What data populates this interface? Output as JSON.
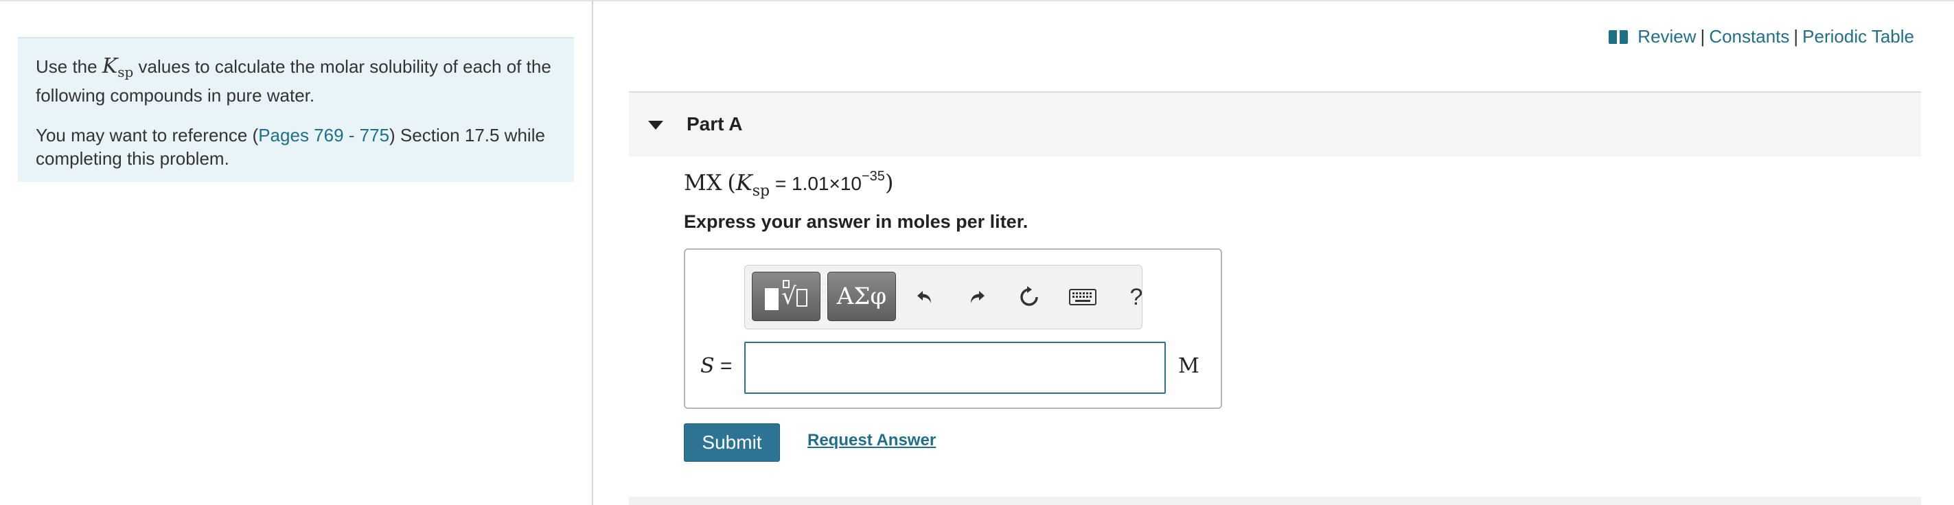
{
  "intro": {
    "line1_pre": "Use the ",
    "k_symbol": "K",
    "k_sub": "sp",
    "line1_post": " values to calculate the molar solubility of each of the following compounds in pure water.",
    "line2_pre": "You may want to reference (",
    "pages_link": "Pages 769 - 775",
    "line2_post": ") Section 17.5 while completing this problem."
  },
  "header": {
    "icon": "book-icon",
    "review": "Review",
    "sep1": "|",
    "constants": "Constants",
    "sep2": "|",
    "periodic_table": "Periodic Table"
  },
  "part": {
    "title": "Part A"
  },
  "question": {
    "compound": "MX",
    "open_paren": "(",
    "k_symbol": "K",
    "k_sub": "sp",
    "eq": " = 1.01×10",
    "exponent": "−35",
    "close_paren": ")",
    "instruction": "Express your answer in moles per liter."
  },
  "toolbar": {
    "greek_label": "ΑΣφ",
    "help_label": "?",
    "icons": [
      "templates-icon",
      "greek-symbols-icon",
      "undo-icon",
      "redo-icon",
      "reset-icon",
      "keyboard-icon",
      "help-icon"
    ]
  },
  "answer": {
    "variable": "S",
    "equals": " =",
    "value": "",
    "unit": "M"
  },
  "actions": {
    "submit": "Submit",
    "request_answer": "Request Answer"
  },
  "colors": {
    "link": "#1f6f8b",
    "submit_bg": "#2d7394",
    "intro_bg": "#e8f4f7",
    "input_border": "#2f6f8b"
  }
}
